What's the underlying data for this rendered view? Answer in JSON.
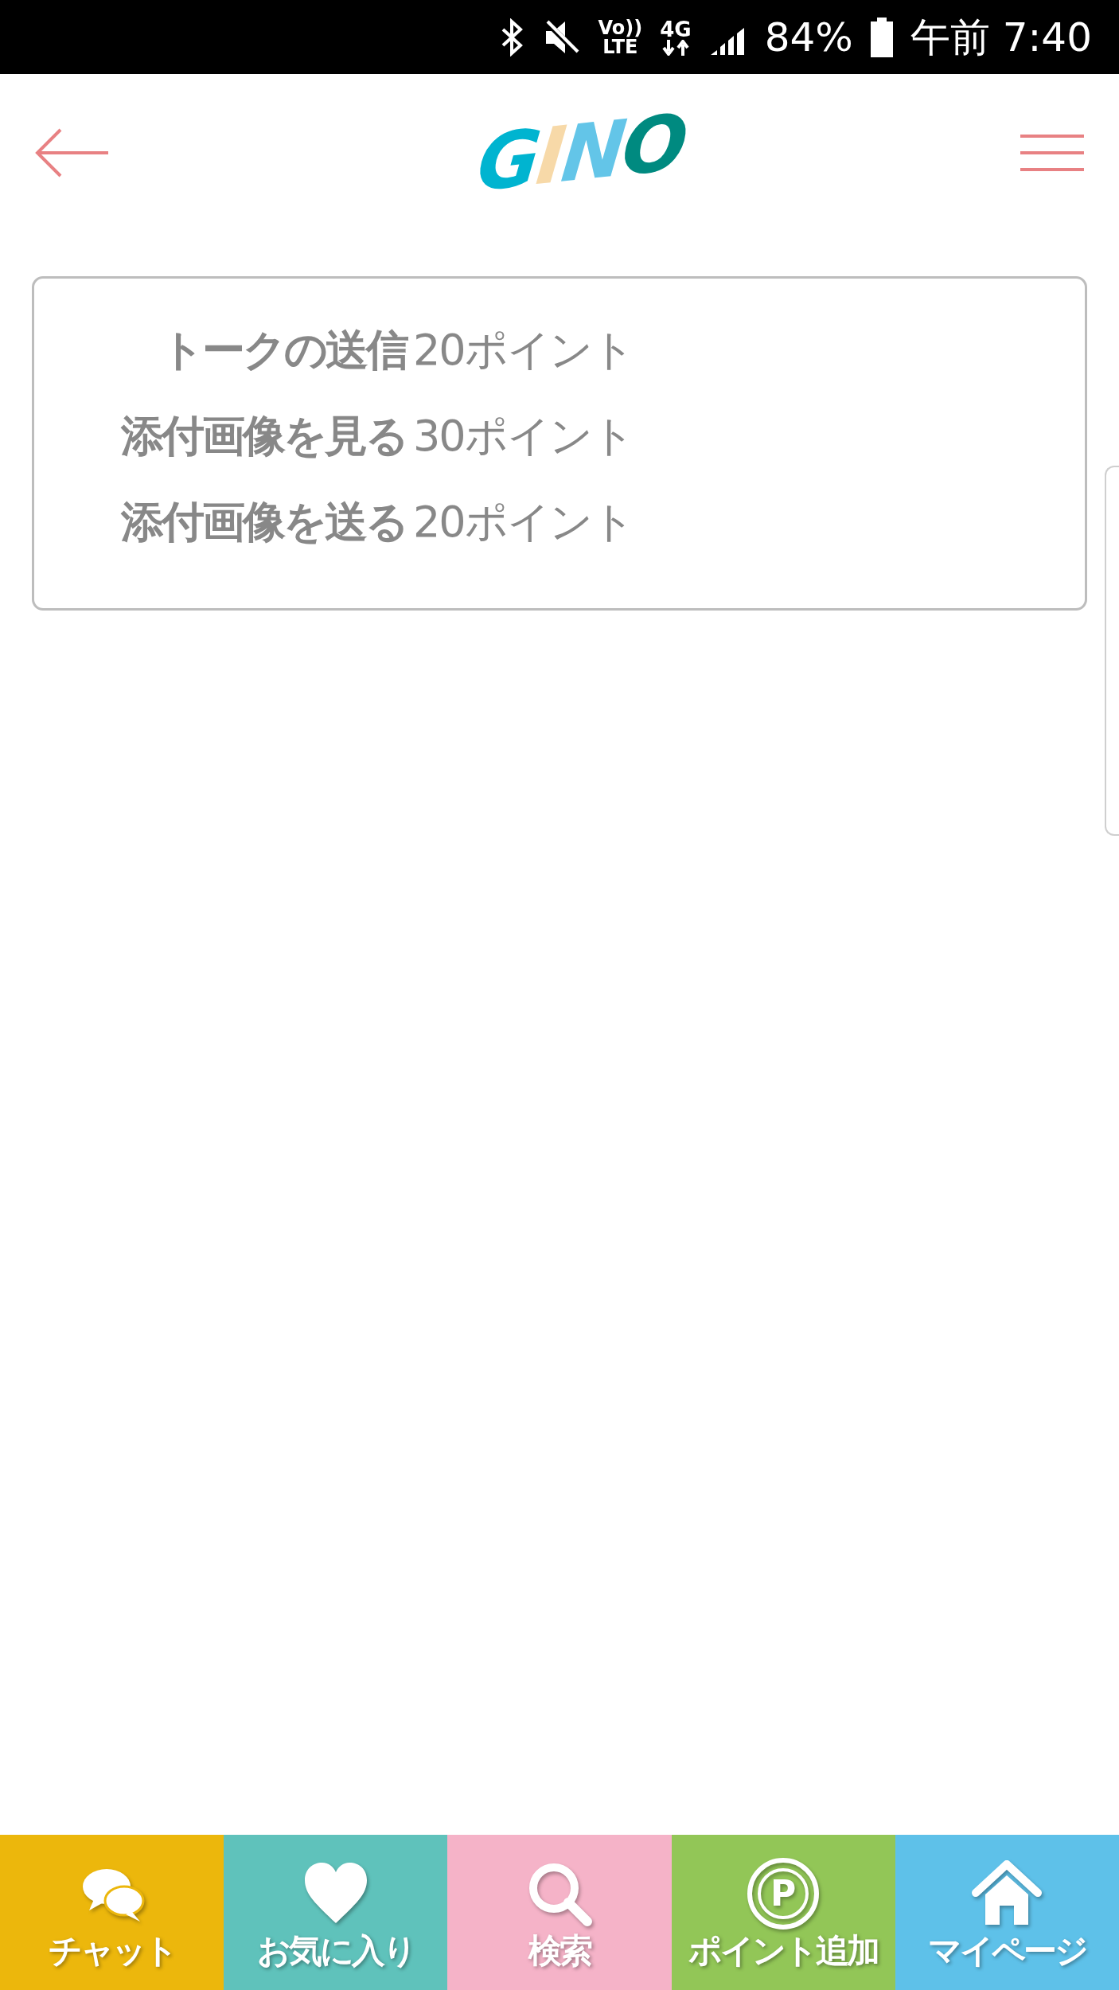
{
  "status_bar": {
    "volte_top": "Vo))",
    "volte_bottom": "LTE",
    "network": "4G",
    "battery": "84%",
    "time": "午前 7:40"
  },
  "header": {
    "logo_letters": [
      {
        "char": "G",
        "color": "#00b4d0"
      },
      {
        "char": "I",
        "color": "#f7d9a8"
      },
      {
        "char": "N",
        "color": "#63c5e8"
      },
      {
        "char": "O",
        "color": "#008a80"
      }
    ]
  },
  "points_table": [
    {
      "action": "トークの送信",
      "cost": "20ポイント"
    },
    {
      "action": "添付画像を見る",
      "cost": "30ポイント"
    },
    {
      "action": "添付画像を送る",
      "cost": "20ポイント"
    }
  ],
  "bottom_nav": [
    {
      "kind": "chat",
      "label": "チャット",
      "color": "#ecb70c"
    },
    {
      "kind": "heart",
      "label": "お気に入り",
      "color": "#5fc2bb"
    },
    {
      "kind": "search",
      "label": "検索",
      "color": "#f5b3c8"
    },
    {
      "kind": "points",
      "label": "ポイント追加",
      "color": "#92c657",
      "icon_text": "P"
    },
    {
      "kind": "home",
      "label": "マイページ",
      "color": "#5ec1e9"
    }
  ]
}
